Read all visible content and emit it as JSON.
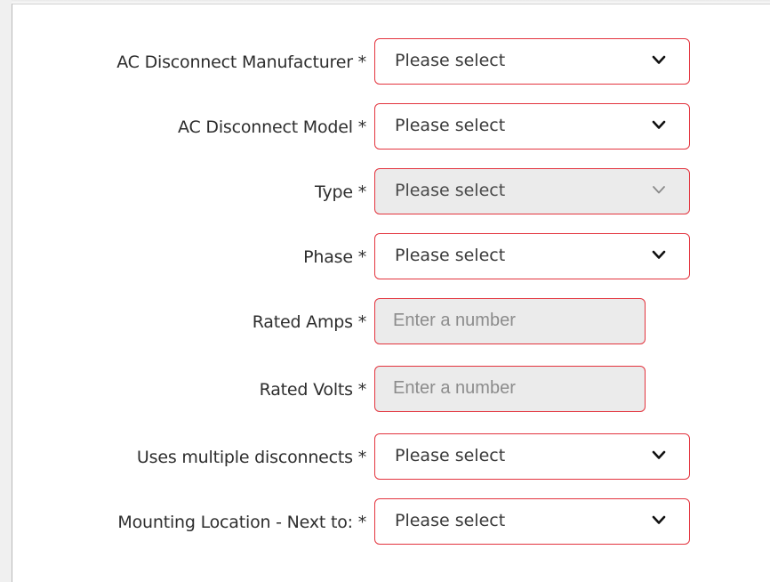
{
  "form": {
    "fields": [
      {
        "label": "AC Disconnect Manufacturer *",
        "kind": "select",
        "value": "Please select",
        "disabled": false,
        "icon": "chevron-down-icon"
      },
      {
        "label": "AC Disconnect Model *",
        "kind": "select",
        "value": "Please select",
        "disabled": false,
        "icon": "chevron-down-icon"
      },
      {
        "label": "Type *",
        "kind": "select",
        "value": "Please select",
        "disabled": true,
        "icon": "chevron-down-icon"
      },
      {
        "label": "Phase *",
        "kind": "select",
        "value": "Please select",
        "disabled": false,
        "icon": "chevron-down-icon"
      },
      {
        "label": "Rated Amps *",
        "kind": "number",
        "placeholder": "Enter a number",
        "disabled": true
      },
      {
        "label": "Rated Volts *",
        "kind": "number",
        "placeholder": "Enter a number",
        "disabled": true
      },
      {
        "label": "Uses multiple disconnects *",
        "kind": "select",
        "value": "Please select",
        "disabled": false,
        "icon": "chevron-down-icon"
      },
      {
        "label": "Mounting Location - Next to: *",
        "kind": "select",
        "value": "Please select",
        "disabled": false,
        "icon": "chevron-down-icon"
      }
    ]
  },
  "colors": {
    "invalid_border": "#e3343e",
    "disabled_fill": "#ebebeb",
    "chevron_active": "#111111",
    "chevron_disabled": "#8a8a8a"
  }
}
